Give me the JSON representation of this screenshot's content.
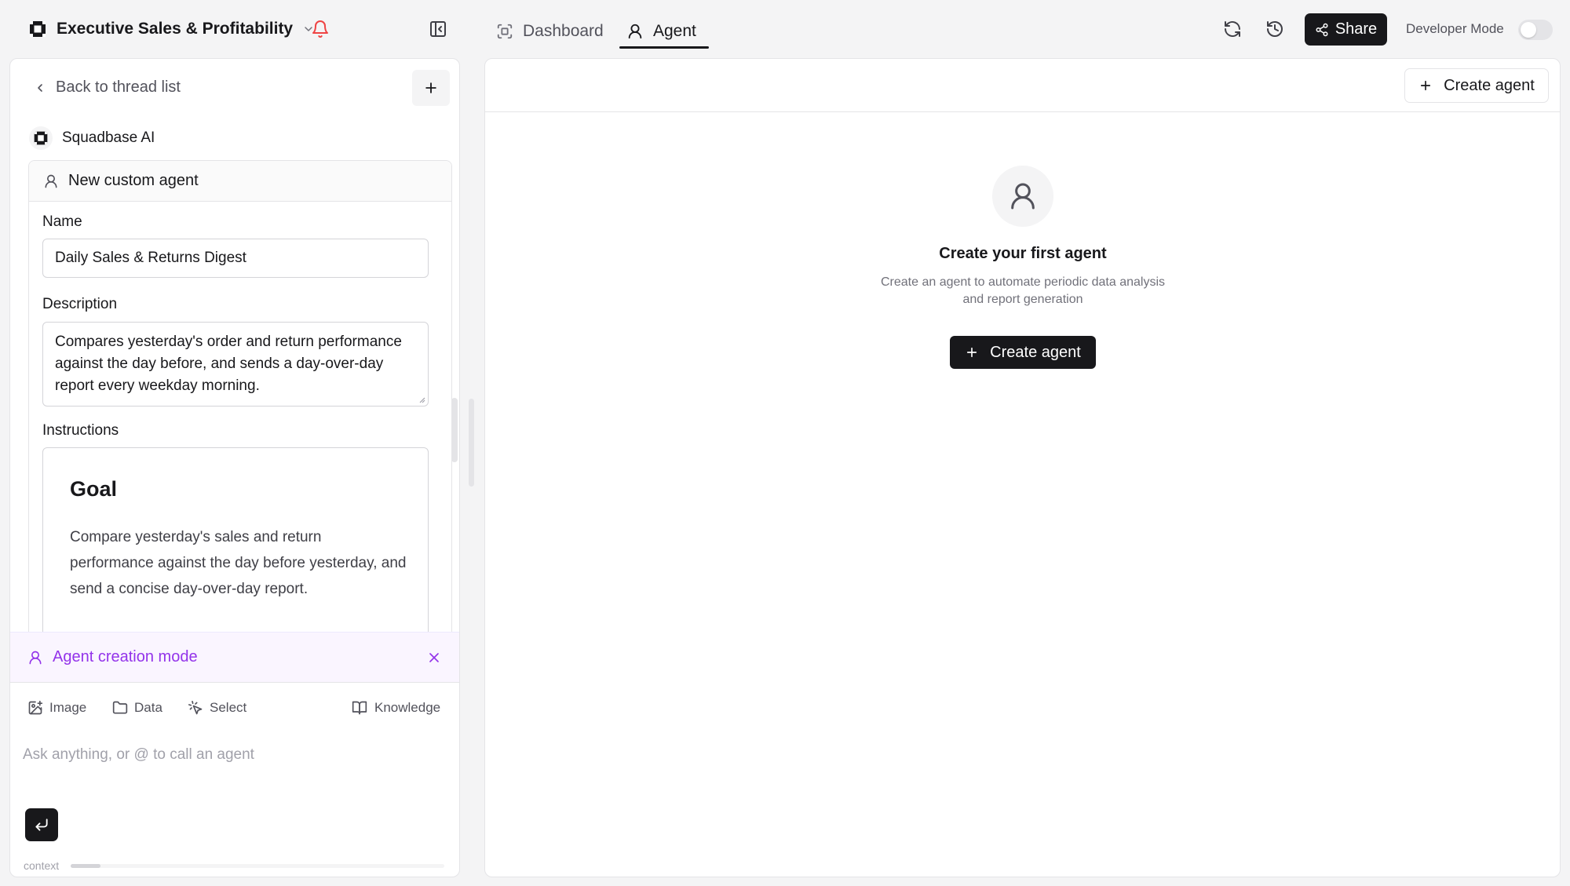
{
  "app": {
    "title": "Executive Sales & Profitability"
  },
  "tabs": [
    {
      "label": "Dashboard",
      "icon": "dashboard-icon",
      "active": false
    },
    {
      "label": "Agent",
      "icon": "user-icon",
      "active": true
    }
  ],
  "header": {
    "share_label": "Share",
    "developer_mode_label": "Developer Mode",
    "developer_mode_on": false
  },
  "thread": {
    "back_label": "Back to thread list",
    "assistant_name": "Squadbase AI"
  },
  "agent_form": {
    "header": "New custom agent",
    "name_label": "Name",
    "name_value": "Daily Sales & Returns Digest",
    "description_label": "Description",
    "description_value": "Compares yesterday's order and return performance against the day before, and sends a day-over-day report every weekday morning.",
    "instructions_label": "Instructions",
    "instructions_heading": "Goal",
    "instructions_body": "Compare yesterday's sales and return performance against the day before yesterday, and send a concise day-over-day report."
  },
  "mode_bar": {
    "label": "Agent creation mode",
    "accent": "#9333ea"
  },
  "composer": {
    "tools": {
      "image": "Image",
      "data": "Data",
      "select": "Select",
      "knowledge": "Knowledge"
    },
    "placeholder": "Ask anything, or @ to call an agent",
    "context_label": "context",
    "context_usage_fraction": 0.08
  },
  "agent_page": {
    "create_button_label": "Create agent",
    "empty_title": "Create your first agent",
    "empty_description": "Create an agent to automate periodic data analysis and report generation",
    "create_primary_label": "Create agent"
  },
  "colors": {
    "bell": "#ef4444",
    "primary": "#18181b",
    "accent": "#9333ea"
  }
}
